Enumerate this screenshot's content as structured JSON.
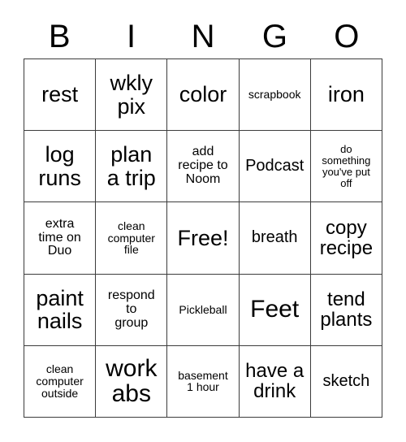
{
  "card": {
    "header_letters": [
      "B",
      "I",
      "N",
      "G",
      "O"
    ],
    "rows": [
      [
        {
          "text": "rest",
          "size": "xl"
        },
        {
          "text": "wkly\npix",
          "size": "xl"
        },
        {
          "text": "color",
          "size": "xl"
        },
        {
          "text": "scrapbook",
          "size": "xs"
        },
        {
          "text": "iron",
          "size": "xl"
        }
      ],
      [
        {
          "text": "log\nruns",
          "size": "xl"
        },
        {
          "text": "plan\na trip",
          "size": "xl"
        },
        {
          "text": "add\nrecipe to\nNoom",
          "size": "sm"
        },
        {
          "text": "Podcast",
          "size": "md"
        },
        {
          "text": "do\nsomething\nyou've put\noff",
          "size": "xxs"
        }
      ],
      [
        {
          "text": "extra\ntime on\nDuo",
          "size": "sm"
        },
        {
          "text": "clean\ncomputer\nfile",
          "size": "xs"
        },
        {
          "text": "Free!",
          "size": "xl"
        },
        {
          "text": "breath",
          "size": "md"
        },
        {
          "text": "copy\nrecipe",
          "size": "lg"
        }
      ],
      [
        {
          "text": "paint\nnails",
          "size": "xl"
        },
        {
          "text": "respond\nto\ngroup",
          "size": "sm"
        },
        {
          "text": "Pickleball",
          "size": "xs"
        },
        {
          "text": "Feet",
          "size": "xxl"
        },
        {
          "text": "tend\nplants",
          "size": "lg"
        }
      ],
      [
        {
          "text": "clean\ncomputer\noutside",
          "size": "xs"
        },
        {
          "text": "work\nabs",
          "size": "xxl"
        },
        {
          "text": "basement\n1 hour",
          "size": "xs"
        },
        {
          "text": "have a\ndrink",
          "size": "lg"
        },
        {
          "text": "sketch",
          "size": "md"
        }
      ]
    ]
  }
}
